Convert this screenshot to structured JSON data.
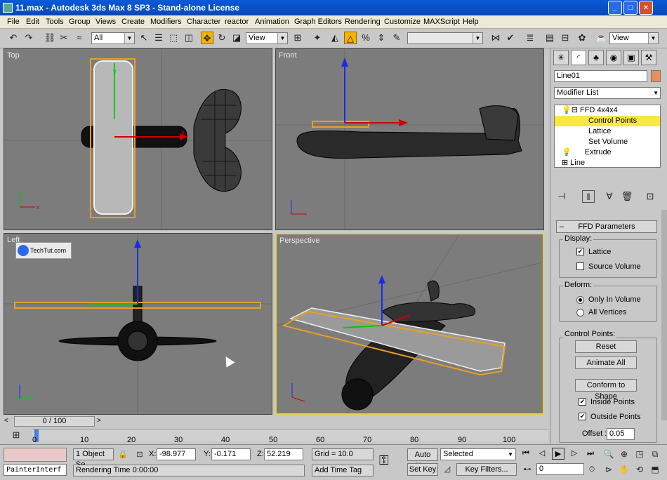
{
  "window": {
    "title": "11.max - Autodesk 3ds Max 8 SP3 - Stand-alone License"
  },
  "menu": [
    "File",
    "Edit",
    "Tools",
    "Group",
    "Views",
    "Create",
    "Modifiers",
    "Character",
    "reactor",
    "Animation",
    "Graph Editors",
    "Rendering",
    "Customize",
    "MAXScript",
    "Help"
  ],
  "toolbar": {
    "filter": "All",
    "ref_coord": "View",
    "ref_coord2": "View",
    "named_sel": ""
  },
  "viewports": {
    "top": "Top",
    "front": "Front",
    "left": "Left",
    "perspective": "Perspective",
    "watermark": "TechTut.com"
  },
  "cmd": {
    "object_name": "Line01",
    "name_color": "#e8905a",
    "modifier_list": "Modifier List",
    "stack": [
      "FFD 4x4x4",
      "Control Points",
      "Lattice",
      "Set Volume",
      "Extrude",
      "Line"
    ],
    "rollout_title": "FFD Parameters",
    "display_group": "Display:",
    "lattice": "Lattice",
    "source_volume": "Source Volume",
    "deform_group": "Deform:",
    "only_in_volume": "Only In Volume",
    "all_vertices": "All Vertices",
    "cp_group": "Control Points:",
    "reset": "Reset",
    "animate_all": "Animate All",
    "conform": "Conform to Shape",
    "inside_points": "Inside Points",
    "outside_points": "Outside Points",
    "offset_label": "Offset :",
    "offset_value": "0.05"
  },
  "timeslider": {
    "label": "0 / 100"
  },
  "trackbar": {
    "ticks": [
      "0",
      "10",
      "20",
      "30",
      "40",
      "50",
      "60",
      "70",
      "80",
      "90",
      "100"
    ]
  },
  "status": {
    "listener": "PainterInterf",
    "selected_count": "1 Object Se",
    "x_label": "X:",
    "x": "-98.977",
    "y_label": "Y:",
    "y": "-0.171",
    "z_label": "Z:",
    "z": "52.219",
    "grid": "Grid = 10.0",
    "prompt": "Rendering Time  0:00:00",
    "add_time_tag": "Add Time Tag",
    "auto_key": "Auto Key",
    "set_key": "Set Key",
    "selected": "Selected",
    "key_filters": "Key Filters...",
    "frame": "0"
  }
}
